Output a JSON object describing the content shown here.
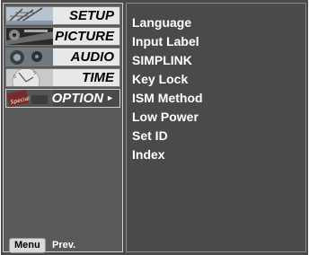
{
  "sidebar": {
    "items": [
      {
        "label": "SETUP",
        "icon": "antenna-thumbnail-icon",
        "active": false
      },
      {
        "label": "PICTURE",
        "icon": "film-reel-thumbnail-icon",
        "active": false
      },
      {
        "label": "AUDIO",
        "icon": "speaker-thumbnail-icon",
        "active": false
      },
      {
        "label": "TIME",
        "icon": "clock-thumbnail-icon",
        "active": false
      },
      {
        "label": "OPTION",
        "icon": "special-thumbnail-icon",
        "active": true,
        "arrow": "►"
      }
    ]
  },
  "footer": {
    "menu_key": "Menu",
    "prev_label": "Prev."
  },
  "options": [
    "Language",
    "Input Label",
    "SIMPLINK",
    "Key Lock",
    "ISM Method",
    "Low Power",
    "Set ID",
    "Index"
  ],
  "thumbnail_text": {
    "special": "Special"
  },
  "colors": {
    "background": "#4a4a4a",
    "inactive_tab": "#e8e8e8",
    "active_tab": "#4a4a4a",
    "text": "#ffffff"
  }
}
